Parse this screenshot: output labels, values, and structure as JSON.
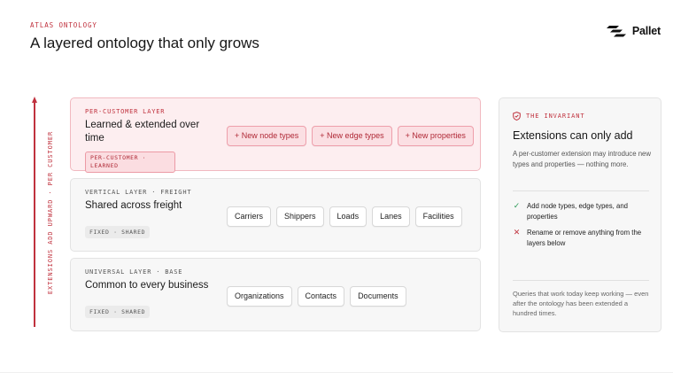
{
  "header": {
    "eyebrow": "ATLAS ONTOLOGY",
    "title": "A layered ontology that only grows",
    "logo_text": "Pallet"
  },
  "axis": {
    "label": "EXTENSIONS ADD UPWARD · PER CUSTOMER",
    "color": "#c0323e"
  },
  "layers": [
    {
      "label": "PER-CUSTOMER LAYER",
      "heading": "Learned & extended over time",
      "tag": "PER-CUSTOMER · LEARNED",
      "chips": [
        "+ New node types",
        "+ New edge types",
        "+ New properties"
      ]
    },
    {
      "label": "VERTICAL LAYER · FREIGHT",
      "heading": "Shared across freight",
      "tag": "FIXED · SHARED",
      "chips": [
        "Carriers",
        "Shippers",
        "Loads",
        "Lanes",
        "Facilities"
      ]
    },
    {
      "label": "UNIVERSAL LAYER · BASE",
      "heading": "Common to every business",
      "tag": "FIXED · SHARED",
      "chips": [
        "Organizations",
        "Contacts",
        "Documents"
      ]
    }
  ],
  "invariant": {
    "eyebrow": "THE INVARIANT",
    "eyebrow_icon": "shield-check-icon",
    "title": "Extensions can only add",
    "description": "A per-customer extension may introduce new types and properties — nothing more.",
    "rules": [
      {
        "icon": "check-icon",
        "text": "Add node types, edge types, and properties"
      },
      {
        "icon": "cross-icon",
        "text": "Rename or remove anything from the layers below"
      }
    ],
    "footer": "Queries that work today keep working — even after the ontology has been extended a hundred times."
  },
  "colors": {
    "accent": "#c0323e",
    "check": "#2d9b58",
    "customer_bg": "#fdeef0",
    "neutral_bg": "#f7f7f7"
  }
}
